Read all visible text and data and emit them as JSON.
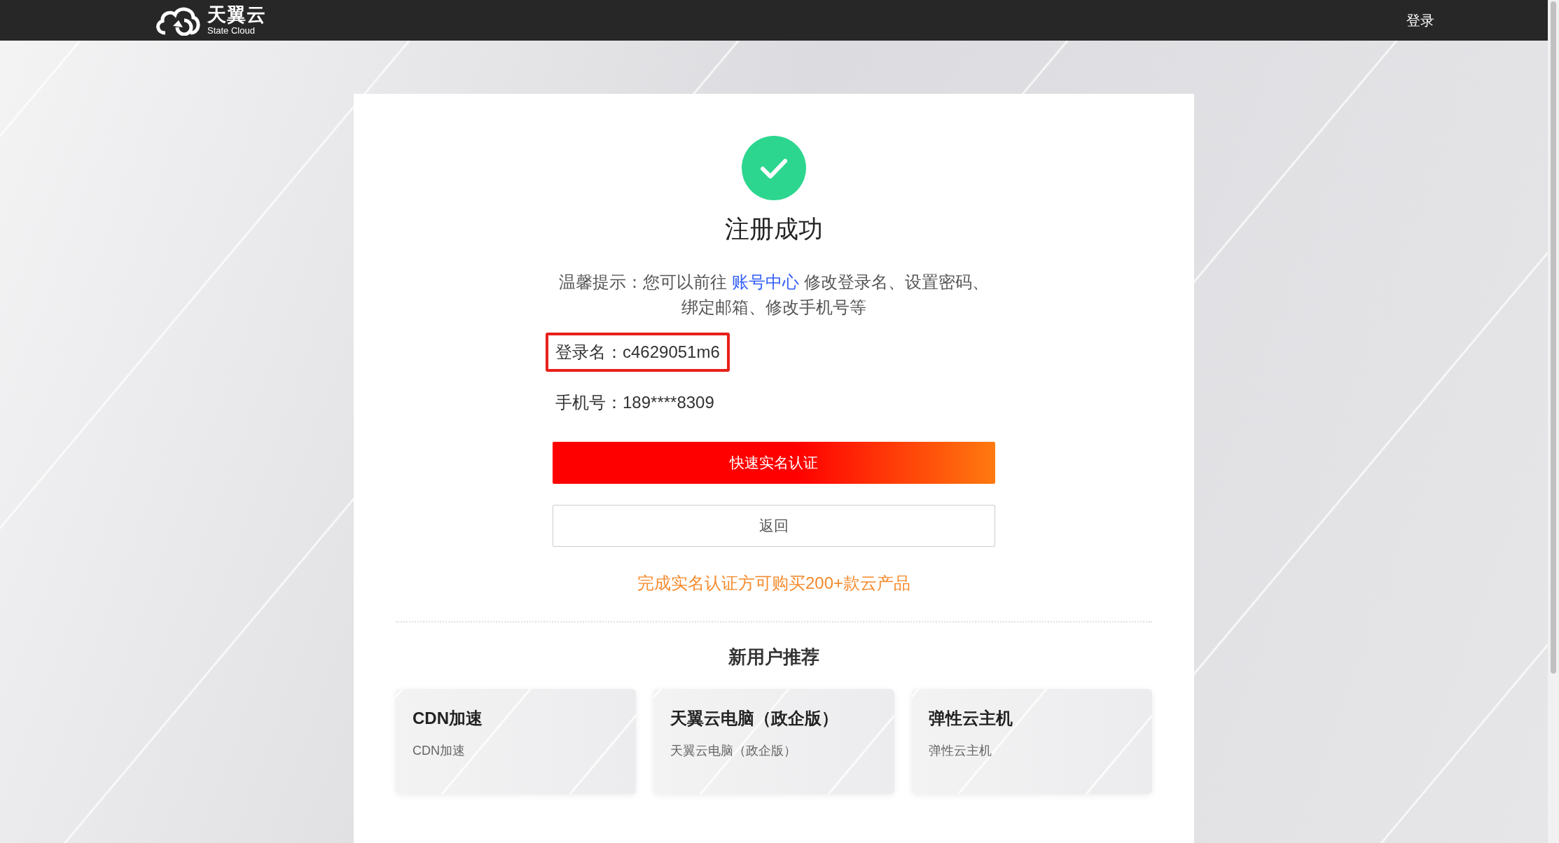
{
  "header": {
    "logo": {
      "name": "天翼云",
      "subtitle": "State Cloud"
    },
    "login_link": "登录"
  },
  "result": {
    "title": "注册成功",
    "tip": {
      "before": "温馨提示：您可以前往 ",
      "link": "账号中心",
      "after": " 修改登录名、设置密码、绑定邮箱、修改手机号等"
    },
    "fields": [
      {
        "label": "登录名：",
        "value": "c4629051m6",
        "highlighted": true
      },
      {
        "label": "手机号：",
        "value": "189****8309",
        "highlighted": false
      }
    ],
    "buttons": [
      {
        "label": "快速实名认证",
        "kind": "primary"
      },
      {
        "label": "返回",
        "kind": "secondary"
      }
    ],
    "notice": "完成实名认证方可购买200+款云产品"
  },
  "recommend": {
    "title": "新用户推荐",
    "products": [
      {
        "name": "CDN加速",
        "description": "CDN加速"
      },
      {
        "name": "天翼云电脑（政企版）",
        "description": "天翼云电脑（政企版）"
      },
      {
        "name": "弹性云主机",
        "description": "弹性云主机"
      }
    ]
  }
}
